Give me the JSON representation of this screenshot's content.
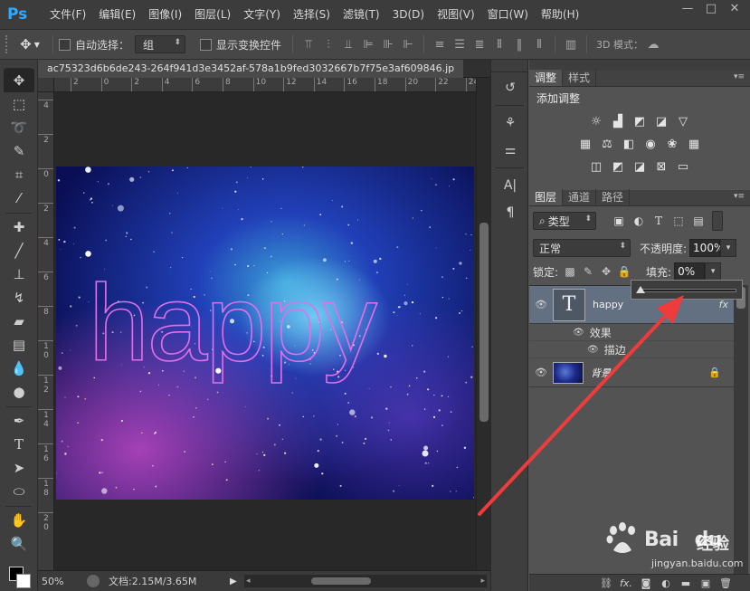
{
  "app": {
    "logo": "Ps"
  },
  "menu": [
    "文件(F)",
    "编辑(E)",
    "图像(I)",
    "图层(L)",
    "文字(Y)",
    "选择(S)",
    "滤镜(T)",
    "3D(D)",
    "视图(V)",
    "窗口(W)",
    "帮助(H)"
  ],
  "window_controls": [
    "—",
    "□",
    "✕"
  ],
  "options": {
    "auto_select_label": "自动选择：",
    "auto_select_value": "组",
    "show_transform_label": "显示变换控件",
    "mode_3d_label": "3D 模式："
  },
  "document": {
    "tab_title": "ac75323d6b6de243-264f941d3e3452af-578a1b9fed3032667b7f75e3af609846.jp",
    "ruler_h": [
      "2",
      "0",
      "2",
      "4",
      "6",
      "8",
      "10",
      "12",
      "14",
      "16",
      "18",
      "20",
      "22",
      "24"
    ],
    "ruler_v": [
      "4",
      "2",
      "0",
      "2",
      "4",
      "6",
      "8",
      "1\n0",
      "1\n2",
      "1\n4",
      "1\n6",
      "1\n8",
      "2\n0"
    ],
    "canvas_text": "happy",
    "zoom": "50%",
    "doc_info": "文档:2.15M/3.65M"
  },
  "adjustments": {
    "tabs": [
      "调整",
      "样式"
    ],
    "title": "添加调整"
  },
  "layers": {
    "tabs": [
      "图层",
      "通道",
      "路径"
    ],
    "filter_kind": "类型",
    "blend_mode": "正常",
    "opacity_label": "不透明度:",
    "opacity_value": "100%",
    "lock_label": "锁定:",
    "fill_label": "填充:",
    "fill_value": "0%",
    "fill_slider_fraction": 0.0,
    "text_layer_name": "happy",
    "text_thumb": "T",
    "fx_badge": "fx",
    "effects_label": "效果",
    "stroke_label": "描边",
    "bg_layer_name": "背景"
  },
  "watermark": {
    "brand": "Bai",
    "brand2": "du",
    "cn": "经验",
    "url": "jingyan.baidu.com"
  },
  "colors": {
    "annotation_arrow": "#ee3b3b",
    "text_stroke": "#e070e8",
    "selected_layer": "#627081"
  }
}
